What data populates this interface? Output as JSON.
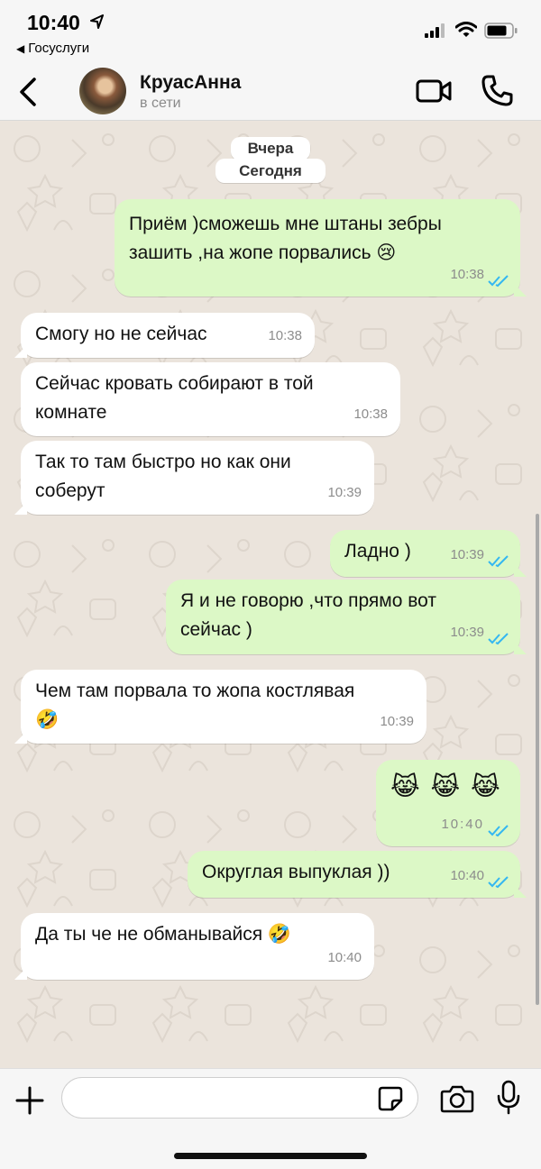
{
  "status_bar": {
    "time": "10:40",
    "back_app": "Госуслуги"
  },
  "header": {
    "contact_name": "КруасАнна",
    "contact_status": "в сети"
  },
  "chat": {
    "date_labels": [
      "Вчера",
      "Сегодня"
    ],
    "messages": [
      {
        "direction": "outgoing",
        "line1": "Приём )сможешь мне штаны зебры",
        "line2": "зашить ,на жопе порвались 😢",
        "time": "10:38",
        "status": "read"
      },
      {
        "direction": "incoming",
        "line1": "Смогу но не сейчас",
        "time": "10:38"
      },
      {
        "direction": "incoming",
        "line1": "Сейчас кровать собирают в той",
        "line2": "комнате",
        "time": "10:38"
      },
      {
        "direction": "incoming",
        "line1": "Так то там быстро но как они",
        "line2": "соберут",
        "time": "10:39"
      },
      {
        "direction": "outgoing",
        "line1": "Ладно )",
        "time": "10:39",
        "status": "read"
      },
      {
        "direction": "outgoing",
        "line1": "Я и не говорю ,что прямо вот",
        "line2": "сейчас )",
        "time": "10:39",
        "status": "read"
      },
      {
        "direction": "incoming",
        "line1": "Чем там порвала то жопа костлявая",
        "line2": "🤣",
        "time": "10:39"
      },
      {
        "direction": "outgoing",
        "line1": "😹 😹 😹",
        "time": "10:40",
        "status": "read"
      },
      {
        "direction": "outgoing",
        "line1": "Округлая выпуклая ))",
        "time": "10:40",
        "status": "read"
      },
      {
        "direction": "incoming",
        "line1": "Да ты че не обманывайся 🤣",
        "time": "10:40"
      }
    ]
  },
  "input": {
    "value": ""
  },
  "colors": {
    "outgoing_bubble": "#dcf8c6",
    "incoming_bubble": "#ffffff",
    "chat_background": "#ebe4dc",
    "read_ticks": "#34b7f1",
    "header_background": "#f6f6f6"
  },
  "icons": [
    "location-arrow-icon",
    "signal-icon",
    "wifi-icon",
    "battery-icon",
    "back-chevron-icon",
    "video-camera-icon",
    "phone-icon",
    "plus-icon",
    "sticker-icon",
    "camera-icon",
    "microphone-icon",
    "double-check-icon"
  ]
}
